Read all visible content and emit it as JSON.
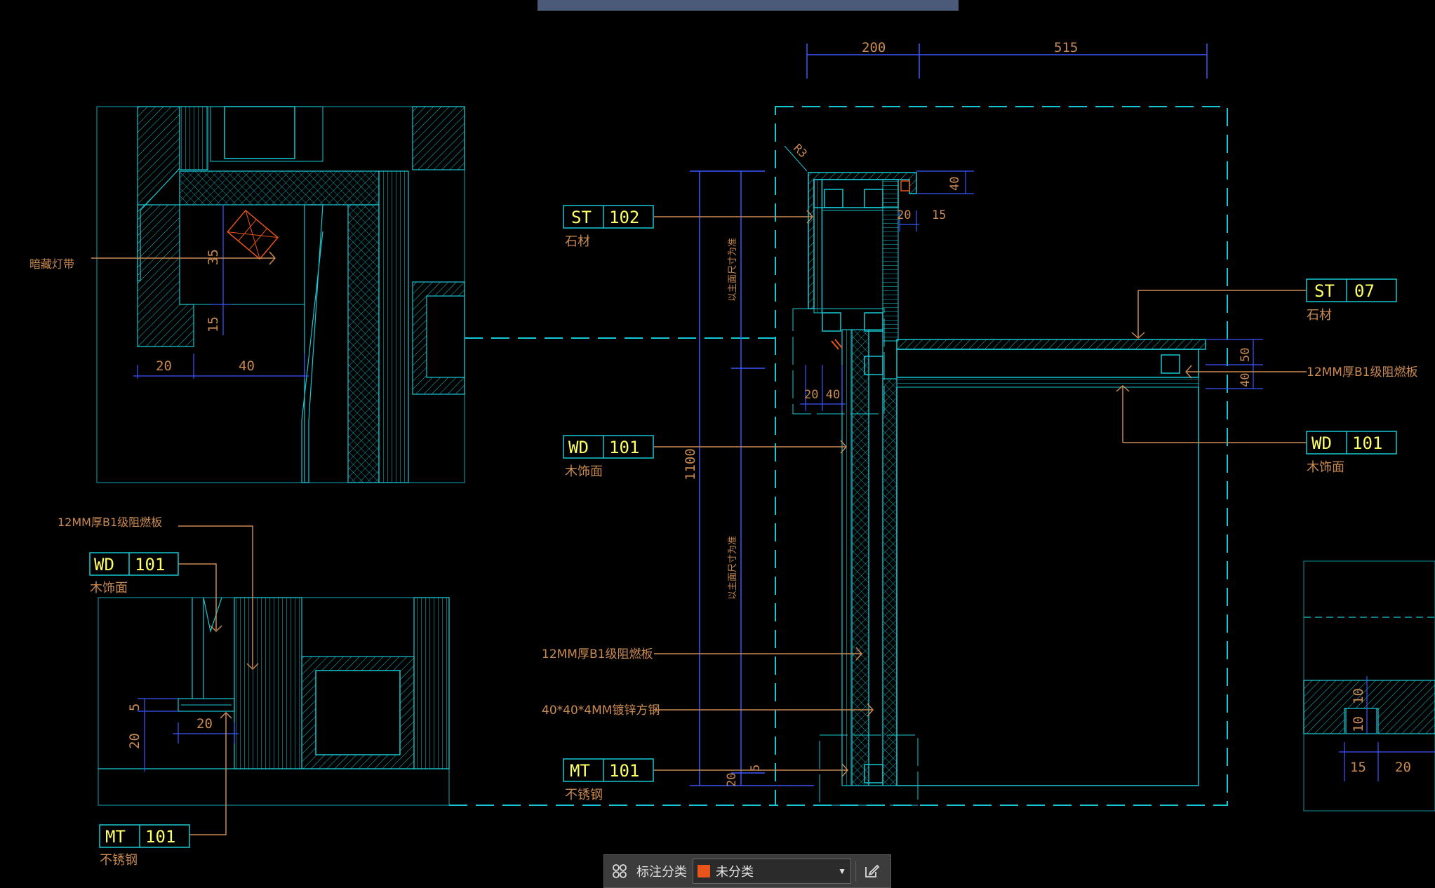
{
  "header": {
    "tab_title": ""
  },
  "colors": {
    "background": "#000000",
    "cyan": "#16c8d4",
    "tag_text": "#ffff66",
    "note_text": "#c98a52",
    "dim_blue": "#3b57ff",
    "leader": "#c98a52",
    "accent_swatch": "#e8541a"
  },
  "dimensions": {
    "top_200": "200",
    "top_515": "515",
    "d_40_top": "40",
    "d_20_top": "20",
    "d_15_top": "15",
    "d_1100": "1100",
    "v_text_1": "以主面尺寸为准",
    "v_text_2": "以主面尺寸为准",
    "d_2040": "20 40",
    "d_5": "5",
    "d_20_bottom": "20",
    "r3": "R3",
    "d_50": "50",
    "d_40_right": "40",
    "dl_35": "35",
    "dl_15": "15",
    "dl_20": "20",
    "dl_40": "40",
    "dbl_5": "5",
    "dbl_20v": "20",
    "dbl_20h": "20",
    "dr_10": "10",
    "dr_10b": "10",
    "dr_15": "15",
    "dr_20": "20"
  },
  "tags": {
    "st102": {
      "code": "ST",
      "num": "102",
      "desc": "石材"
    },
    "st07": {
      "code": "ST",
      "num": "07",
      "desc": "石材"
    },
    "wd101_mid": {
      "code": "WD",
      "num": "101",
      "desc": "木饰面"
    },
    "wd101_right": {
      "code": "WD",
      "num": "101",
      "desc": "木饰面"
    },
    "wd101_left": {
      "code": "WD",
      "num": "101",
      "desc": "木饰面"
    },
    "mt101_mid": {
      "code": "MT",
      "num": "101",
      "desc": "不锈钢"
    },
    "mt101_left": {
      "code": "MT",
      "num": "101",
      "desc": "不锈钢"
    }
  },
  "notes": {
    "hidden_light": "暗藏灯带",
    "board_right": "12MM厚B1级阻燃板",
    "board_left": "12MM厚B1级阻燃板",
    "board_mid": "12MM厚B1级阻燃板",
    "steel_tube": "40*40*4MM镀锌方钢"
  },
  "toolbar": {
    "icon_left": "grid-icon",
    "label": "标注分类",
    "selected": "未分类",
    "icon_right": "edit-icon"
  }
}
